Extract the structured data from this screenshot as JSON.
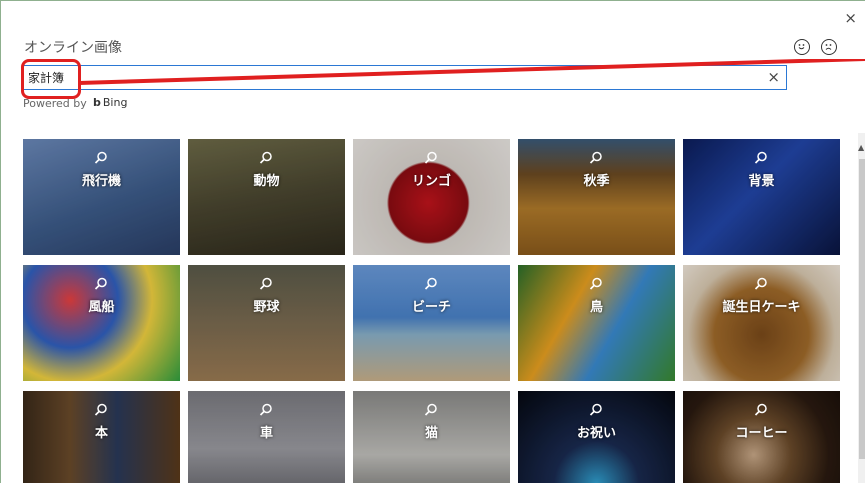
{
  "dialog": {
    "title": "オンライン画像",
    "close_glyph": "×",
    "feedback": {
      "smile": "smile-icon",
      "frown": "frown-icon"
    }
  },
  "search": {
    "value": "家計簿",
    "clear_glyph": "×"
  },
  "powered_by": {
    "text": "Powered by",
    "bing_logo": "b",
    "bing_text": "Bing"
  },
  "annotation": {
    "color": "#e02020"
  },
  "tiles": [
    {
      "label": "飛行機",
      "bg": "linear-gradient(160deg,#6a88b8 0%,#3d5c8a 55%,#2a3e66 100%)"
    },
    {
      "label": "動物",
      "bg": "linear-gradient(170deg,#6d6a48 0%,#4a4630 50%,#2e2a1c 100%)"
    },
    {
      "label": "リンゴ",
      "bg": "radial-gradient(circle at 48% 55%,#c0141c 0%,#8a0c12 38%,#d8d2cc 40%,#e9e6e2 100%)"
    },
    {
      "label": "秋季",
      "bg": "linear-gradient(180deg,#3a5a7a 0%,#6b4a22 30%,#b07a2a 60%,#8a5a1c 100%)"
    },
    {
      "label": "背景",
      "bg": "linear-gradient(135deg,#0c1d5a 0%,#2246a8 45%,#0a1540 100%)"
    },
    {
      "label": "風船",
      "bg": "radial-gradient(circle at 30% 30%,#e84040 0%,#3060c0 35%,#f0d040 60%,#30a040 100%)"
    },
    {
      "label": "野球",
      "bg": "linear-gradient(180deg,#5a5a4a 0%,#7a6a50 50%,#9a7a52 100%)"
    },
    {
      "label": "ビーチ",
      "bg": "linear-gradient(180deg,#6a9ad8 0%,#4a82c8 45%,#8ab0c8 60%,#c8b08a 100%)"
    },
    {
      "label": "鳥",
      "bg": "linear-gradient(120deg,#2a6e2a 0%,#e8a020 35%,#3a8ad0 60%,#3a8a30 100%)"
    },
    {
      "label": "誕生日ケーキ",
      "bg": "radial-gradient(circle at 50% 60%,#7a4a1a 0%,#a06a2a 45%,#d8c8b0 70%,#efe6da 100%)"
    },
    {
      "label": "本",
      "bg": "linear-gradient(90deg,#3a2a1a 0%,#6a4a2a 30%,#2a3a5a 60%,#5a3a1a 100%)"
    },
    {
      "label": "車",
      "bg": "linear-gradient(180deg,#7a7a80 0%,#9a9aa0 50%,#5a5a60 100%)"
    },
    {
      "label": "猫",
      "bg": "linear-gradient(180deg,#8a8a88 0%,#c0bfbb 55%,#6a6a68 100%)"
    },
    {
      "label": "お祝い",
      "bg": "radial-gradient(circle at 50% 80%,#30a0d0 0%,#1a2a50 35%,#050810 100%)"
    },
    {
      "label": "コーヒー",
      "bg": "radial-gradient(circle at 45% 55%,#c8a888 0%,#6a4a2a 35%,#2a1a10 70%,#1a100a 100%)"
    }
  ]
}
